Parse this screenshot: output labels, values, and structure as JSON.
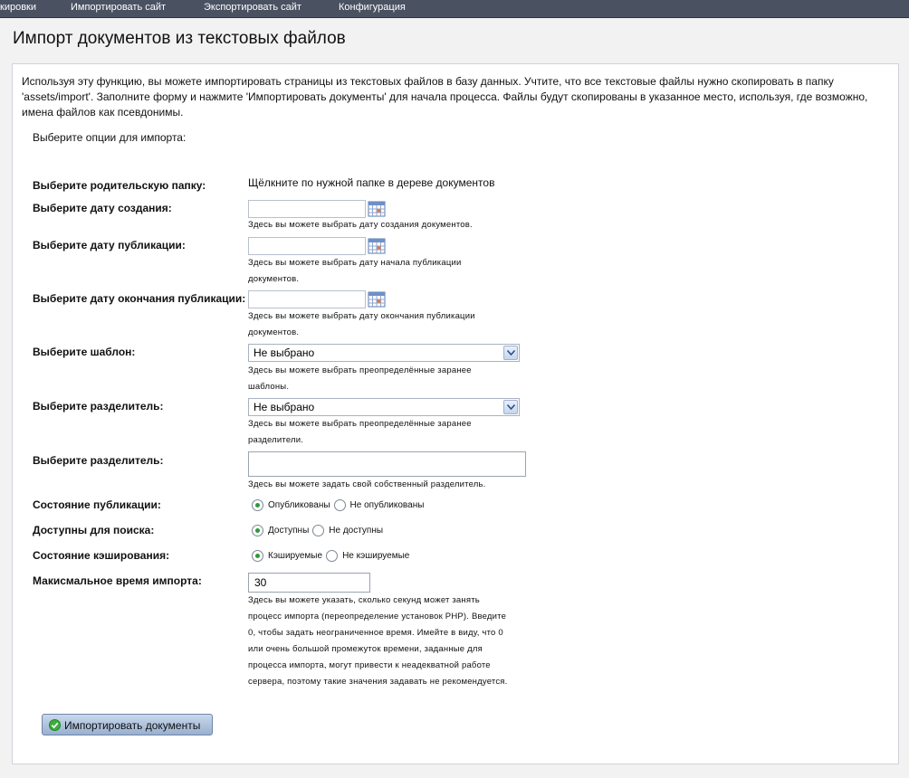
{
  "nav": {
    "items": [
      "кировки",
      "Импортировать сайт",
      "Экспортировать сайт",
      "Конфигурация"
    ]
  },
  "page": {
    "title": "Импорт документов из текстовых файлов",
    "intro_line1": "Используя эту функцию, вы можете импортировать страницы из текстовых файлов в базу данных. Учтите, что все текстовые файлы нужно скопировать в папку",
    "intro_line2": "'assets/import'. Заполните форму и нажмите 'Импортировать документы' для начала процесса. Файлы будут скопированы в указанное место, используя, где возможно,",
    "intro_line3": "имена файлов как псевдонимы.",
    "choose_options": "Выберите опции для импорта:"
  },
  "form": {
    "parent": {
      "label": "Выберите родительскую папку:",
      "value": "Щёлкните по нужной папке в дереве документов"
    },
    "created": {
      "label": "Выберите дату создания:",
      "help": "Здесь вы можете выбрать дату создания документов.",
      "value": ""
    },
    "pub": {
      "label": "Выберите дату публикации:",
      "help": "Здесь вы можете выбрать дату начала публикации документов.",
      "value": ""
    },
    "unpub": {
      "label": "Выберите дату окончания публикации:",
      "help": "Здесь вы можете выбрать дату окончания публикации документов.",
      "value": ""
    },
    "template": {
      "label": "Выберите шаблон:",
      "selected": "Не выбрано",
      "help": "Здесь вы можете выбрать преопределённые заранее шаблоны."
    },
    "separator": {
      "label": "Выберите разделитель:",
      "selected": "Не выбрано",
      "help": "Здесь вы можете выбрать преопределённые заранее разделители."
    },
    "custom_separator": {
      "label": "Выберите разделитель:",
      "value": "",
      "help": "Здесь вы можете задать свой собственный разделитель."
    },
    "publish_state": {
      "label": "Состояние публикации:",
      "opt1": "Опубликованы",
      "opt2": "Не опубликованы",
      "selected": "Опубликованы"
    },
    "searchable": {
      "label": "Доступны для поиска:",
      "opt1": "Доступны",
      "opt2": "Не доступны",
      "selected": "Доступны"
    },
    "cache": {
      "label": "Состояние кэширования:",
      "opt1": "Кэшируемые",
      "opt2": "Не кэшируемые",
      "selected": "Кэшируемые"
    },
    "max_time": {
      "label": "Макисмальное время импорта:",
      "value": "30",
      "help": "Здесь вы можете указать, сколько секунд может занять процесс импорта (переопределение установок PHP). Введите 0, чтобы задать неограниченное время. Имейте в виду, что 0 или очень большой промежуток времени, заданные для процесса импорта, могут привести к неадекватной работе сервера, поэтому такие значения задавать не рекомендуется."
    }
  },
  "actions": {
    "import_label": "Импортировать документы"
  },
  "colors": {
    "topbar": "#4a5262",
    "accent_green": "#2c9a3a",
    "button": "#a9bdd8"
  }
}
